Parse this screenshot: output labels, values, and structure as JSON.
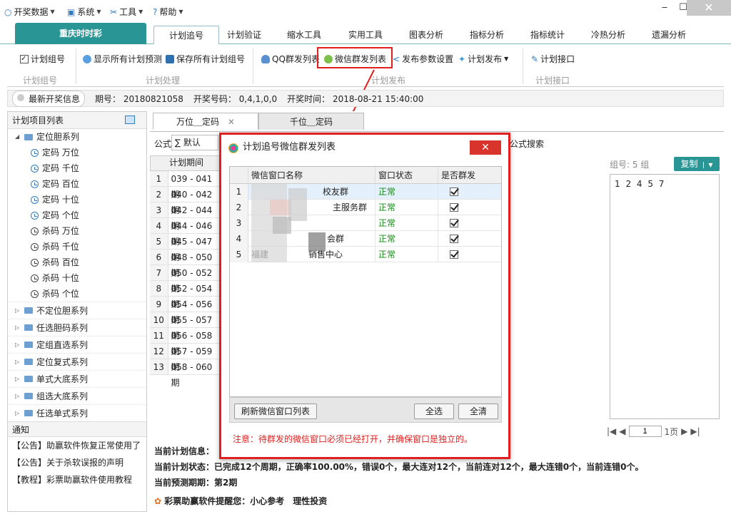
{
  "titlebar": {
    "menus": [
      "开奖数据",
      "系统",
      "工具",
      "帮助"
    ],
    "min_label": "‒",
    "max_label": "☐",
    "close_label": "✕"
  },
  "tabs": {
    "brand": "重庆时时彩",
    "items": [
      "计划追号",
      "计划验证",
      "缩水工具",
      "实用工具",
      "图表分析",
      "指标分析",
      "指标统计",
      "冷热分析",
      "遗漏分析"
    ]
  },
  "ribbon": {
    "plan_group_btn": "计划组号",
    "plan_group_label": "计划组号",
    "show_all": "显示所有计划预测",
    "save_all": "保存所有计划组号",
    "handle_label": "计划处理",
    "qq_send": "QQ群发列表",
    "wechat_send": "微信群发列表",
    "publish_params": "发布参数设置",
    "plan_publish": "计划发布",
    "publish_label": "计划发布",
    "plan_api": "计划接口",
    "api_label": "计划接口"
  },
  "infobar": {
    "label": "最新开奖信息",
    "period_label": "期号：",
    "period": "20180821058",
    "number_label": "开奖号码：",
    "number": "0,4,1,0,0",
    "time_label": "开奖时间：",
    "time": "2018-08-21 15:40:00"
  },
  "sidebar": {
    "title": "计划项目列表",
    "root": "定位胆系列",
    "leaves": [
      "定码 万位",
      "定码 千位",
      "定码 百位",
      "定码 十位",
      "定码 个位",
      "杀码 万位",
      "杀码 千位",
      "杀码 百位",
      "杀码 十位",
      "杀码 个位"
    ],
    "collapsed": [
      "不定位胆系列",
      "任选胆码系列",
      "定组直选系列",
      "定位复式系列",
      "单式大底系列",
      "组选大底系列",
      "任选单式系列"
    ],
    "notice_title": "通知",
    "notices": [
      "【公告】助赢软件恢复正常使用了",
      "【公告】关于杀软误报的声明",
      "【教程】彩票助赢软件使用教程"
    ]
  },
  "main": {
    "subtab1": "万位＿定码",
    "subtab2": "千位＿定码",
    "formula_label": "公式",
    "formula_value": "∑ 默认",
    "formula_search": "公式搜索",
    "grid_head": "计划期间",
    "rows": [
      {
        "n": "1",
        "v": "039 - 041期"
      },
      {
        "n": "2",
        "v": "040 - 042期"
      },
      {
        "n": "3",
        "v": "042 - 044期"
      },
      {
        "n": "4",
        "v": "044 - 046期"
      },
      {
        "n": "5",
        "v": "045 - 047期"
      },
      {
        "n": "6",
        "v": "048 - 050期"
      },
      {
        "n": "7",
        "v": "050 - 052期"
      },
      {
        "n": "8",
        "v": "052 - 054期"
      },
      {
        "n": "9",
        "v": "054 - 056期"
      },
      {
        "n": "10",
        "v": "055 - 057期"
      },
      {
        "n": "11",
        "v": "056 - 058期"
      },
      {
        "n": "12",
        "v": "057 - 059期"
      },
      {
        "n": "13",
        "v": "058 - 060期"
      }
    ],
    "group_label": "组号: 5 组",
    "copy_label": "复制",
    "numbers": "1 2 4 5 7",
    "page_value": "1",
    "page_total": "1页",
    "status_info_label": "当前计划信息：",
    "status_state_label": "当前计划状态：",
    "status_state_value": "已完成12个周期，正确率100.00%，错误0个，最大连对12个，当前连对12个，最大连错0个，当前连错0个。",
    "status_period_label": "当前预测期期：",
    "status_period_value": "第2期",
    "slogan": "彩票助赢软件提醒您：小心参考　理性投资"
  },
  "dialog": {
    "title": "计划追号微信群发列表",
    "close_label": "✕",
    "col_name": "微信窗口名称",
    "col_state": "窗口状态",
    "col_send": "是否群发",
    "rows": [
      {
        "n": "1",
        "name": "校友群",
        "state": "正常"
      },
      {
        "n": "2",
        "name": "主服务群",
        "state": "正常"
      },
      {
        "n": "3",
        "name": "",
        "state": "正常"
      },
      {
        "n": "4",
        "name": "会群",
        "state": "正常"
      },
      {
        "n": "5",
        "name": "福建",
        "name2": "销售中心",
        "state": "正常"
      }
    ],
    "refresh": "刷新微信窗口列表",
    "select_all": "全选",
    "clear_all": "全清",
    "note": "注意：待群发的微信窗口必须已经打开，并确保窗口是独立的。"
  },
  "colors": {
    "accent": "#2a9595",
    "highlight": "#e02020",
    "ok": "#168a16"
  }
}
